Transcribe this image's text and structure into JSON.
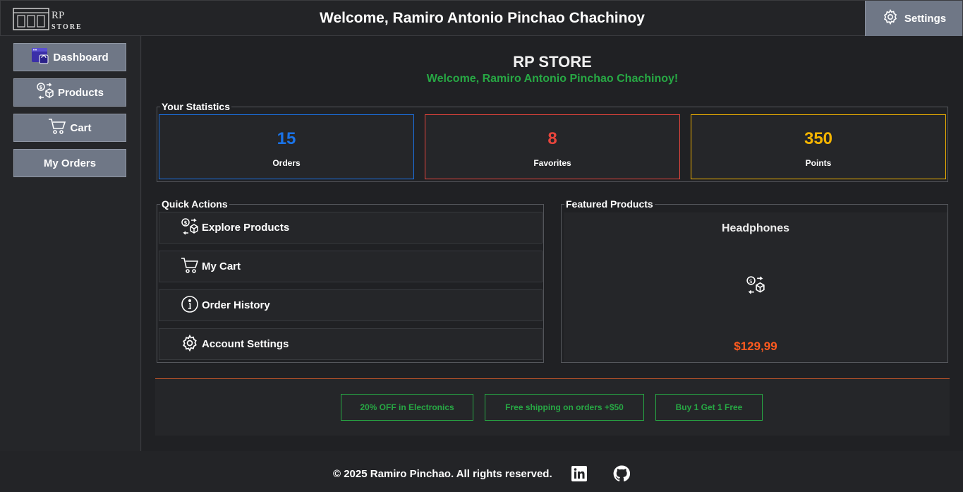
{
  "header": {
    "logo_rp": "RP",
    "logo_store": "STORE",
    "title": "Welcome, Ramiro Antonio Pinchao Chachinoy",
    "settings_label": "Settings"
  },
  "sidebar": {
    "items": [
      {
        "label": "Dashboard",
        "icon": "dashboard-icon"
      },
      {
        "label": "Products",
        "icon": "products-exchange-icon"
      },
      {
        "label": "Cart",
        "icon": "cart-icon"
      },
      {
        "label": "My Orders"
      }
    ]
  },
  "main": {
    "store_title": "RP STORE",
    "welcome": "Welcome, Ramiro Antonio Pinchao Chachinoy!",
    "stats_legend": "Your Statistics",
    "stats": [
      {
        "value": "15",
        "label": "Orders",
        "color": "#1a73e8"
      },
      {
        "value": "8",
        "label": "Favorites",
        "color": "#e8453c"
      },
      {
        "value": "350",
        "label": "Points",
        "color": "#f4b400"
      }
    ],
    "quick_actions_legend": "Quick Actions",
    "quick_actions": [
      {
        "label": "Explore Products",
        "icon": "products-exchange-icon"
      },
      {
        "label": "My Cart",
        "icon": "cart-icon"
      },
      {
        "label": "Order History",
        "icon": "info-icon"
      },
      {
        "label": "Account Settings",
        "icon": "gear-icon"
      }
    ],
    "featured_legend": "Featured Products",
    "featured": {
      "name": "Headphones",
      "price": "$129,99",
      "icon": "products-exchange-icon"
    },
    "promotions": [
      "20% OFF in Electronics",
      "Free shipping on orders +$50",
      "Buy 1 Get 1 Free"
    ]
  },
  "footer": {
    "copyright": "© 2025 Ramiro Pinchao. All rights reserved."
  },
  "colors": {
    "accent_green": "#27a844",
    "price_orange": "#ff5a1f",
    "button_gray": "#6f7786"
  }
}
